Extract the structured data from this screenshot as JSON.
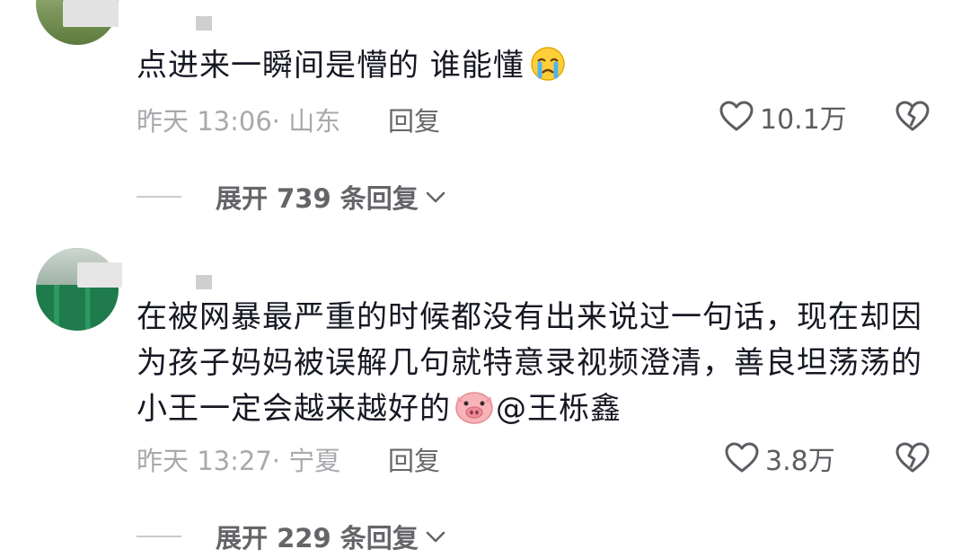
{
  "comments": [
    {
      "text": "点进来一瞬间是懵的 谁能懂",
      "emoji_icon": "crying-face-emoji",
      "time": "昨天 13:06",
      "location": "· 山东",
      "reply_label": "回复",
      "likes": "10.1万",
      "expand_label": "展开 739 条回复"
    },
    {
      "text": "在被网暴最严重的时候都没有出来说过一句话，现在却因为孩子妈妈被误解几句就特意录视频澄清，善良坦荡荡的小王一定会越来越好的",
      "emoji_icon": "pig-face-emoji",
      "mention": "@王栎鑫",
      "time": "昨天 13:27",
      "location": "· 宁夏",
      "reply_label": "回复",
      "likes": "3.8万",
      "expand_label": "展开 229 条回复"
    }
  ],
  "icons": {
    "like": "heart-outline-icon",
    "dislike": "broken-heart-icon",
    "expand": "chevron-down-icon"
  }
}
